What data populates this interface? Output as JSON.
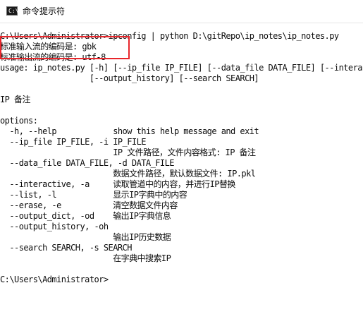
{
  "window": {
    "title": "命令提示符",
    "icon_text": "C:\\",
    "icon": "cmd-icon"
  },
  "console": {
    "lines": [
      "C:\\Users\\Administrator>ipconfig | python D:\\gitRepo\\ip_notes\\ip_notes.py",
      "标准输入流的编码是: gbk",
      "标准输出流的编码是: utf-8",
      "usage: ip_notes.py [-h] [--ip_file IP_FILE] [--data_file DATA_FILE] [--interactive]",
      "                   [--output_history] [--search SEARCH]",
      "",
      "IP 备注",
      "",
      "options:",
      "  -h, --help            show this help message and exit",
      "  --ip_file IP_FILE, -i IP_FILE",
      "                        IP 文件路径，文件内容格式: IP 备注",
      "  --data_file DATA_FILE, -d DATA_FILE",
      "                        数据文件路径，默认数据文件: IP.pkl",
      "  --interactive, -a     读取管道中的内容，并进行IP替换",
      "  --list, -l            显示IP字典中的内容",
      "  --erase, -e           清空数据文件内容",
      "  --output_dict, -od    输出IP字典信息",
      "  --output_history, -oh",
      "                        输出IP历史数据",
      "  --search SEARCH, -s SEARCH",
      "                        在字典中搜索IP",
      "",
      "C:\\Users\\Administrator>"
    ]
  },
  "colors": {
    "background": "#ffffff",
    "text": "#0c0c0c",
    "highlight": "#e8262b"
  }
}
